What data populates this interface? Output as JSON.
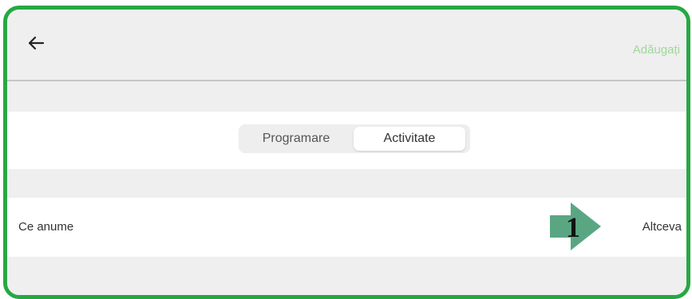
{
  "header": {
    "back_icon": "arrow-left-icon",
    "add_label": "Adăugați"
  },
  "segmented": {
    "options": [
      "Programare",
      "Activitate"
    ],
    "selected": "Activitate"
  },
  "row": {
    "label": "Ce anume",
    "value": "Altceva"
  },
  "callout": {
    "number": "1",
    "color": "#5aa683"
  },
  "colors": {
    "frame": "#26a844",
    "accent": "#9fd79a"
  }
}
